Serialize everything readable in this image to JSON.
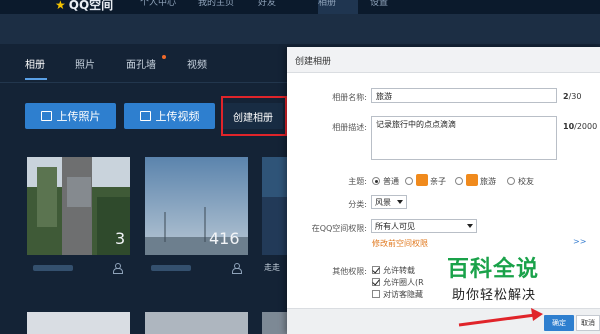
{
  "topnav": {
    "logo_text": "QQ空间",
    "items": [
      "个人中心",
      "我的主页",
      "好友",
      "相册",
      "设置"
    ]
  },
  "tabs": [
    {
      "label": "相册",
      "active": true
    },
    {
      "label": "照片",
      "active": false
    },
    {
      "label": "面孔墙",
      "active": false
    },
    {
      "label": "视频",
      "active": false
    }
  ],
  "toolbar": {
    "upload_photo_label": "上传照片",
    "upload_video_label": "上传视频",
    "create_album_label": "创建相册"
  },
  "albums": [
    {
      "count": "3",
      "owner_visible": true
    },
    {
      "count": "416",
      "owner_visible": true
    },
    {
      "count": "",
      "footer_text": "走走",
      "owner_visible": false
    }
  ],
  "dialog": {
    "title": "创建相册",
    "name_label": "相册名称:",
    "name_value": "旅游",
    "name_counter_current": "2",
    "name_counter_max": "/30",
    "desc_label": "相册描述:",
    "desc_value": "记录旅行中的点点滴滴",
    "desc_counter_current": "10",
    "desc_counter_max": "/2000",
    "theme_label": "主题:",
    "theme_options": [
      {
        "label": "普通",
        "selected": true,
        "icon": "none"
      },
      {
        "label": "亲子",
        "selected": false,
        "icon": "child-icon"
      },
      {
        "label": "旅游",
        "selected": false,
        "icon": "travel-icon"
      },
      {
        "label": "校友",
        "selected": false,
        "icon": "none"
      }
    ],
    "category_label": "分类:",
    "category_value": "风景",
    "permission_label": "在QQ空间权限:",
    "permission_value": "所有人可见",
    "permission_link": "修改前空间权限",
    "other_label": "其他权限:",
    "other_options": [
      {
        "label": "允许转载",
        "checked": true
      },
      {
        "label": "允许圈人(R",
        "checked": true
      },
      {
        "label": "对访客隐藏",
        "checked": false
      }
    ],
    "ok_label": "确定",
    "cancel_label": "取消"
  },
  "watermark": {
    "main": "百科全说",
    "sub": "助你轻松解决"
  },
  "colors": {
    "accent_blue": "#2e7fcf",
    "highlight_red": "#e0242a",
    "watermark_green": "#1aa24a"
  }
}
